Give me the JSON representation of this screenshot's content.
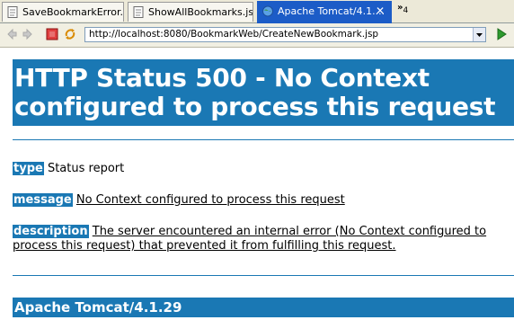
{
  "tabs": [
    {
      "label": "SaveBookmarkError...",
      "icon": "file-icon",
      "active": false
    },
    {
      "label": "ShowAllBookmarks.jsp",
      "icon": "file-icon",
      "active": false
    },
    {
      "label": "Apache Tomcat/4.1....",
      "icon": "globe-icon",
      "active": true
    }
  ],
  "tab_overflow": {
    "chevron": "»",
    "count": "4"
  },
  "toolbar": {
    "url": "http://localhost:8080/BookmarkWeb/CreateNewBookmark.jsp"
  },
  "page": {
    "heading": "HTTP Status 500 - No Context configured to process this request",
    "type_label": "type",
    "type_value": "Status report",
    "message_label": "message",
    "message_value": "No Context configured to process this request",
    "description_label": "description",
    "description_value": "The server encountered an internal error (No Context configured to process this request) that prevented it from fulfilling this request.",
    "footer": "Apache Tomcat/4.1.29"
  },
  "colors": {
    "accent": "#1a78b4",
    "tab_active": "#1c5cc7"
  }
}
